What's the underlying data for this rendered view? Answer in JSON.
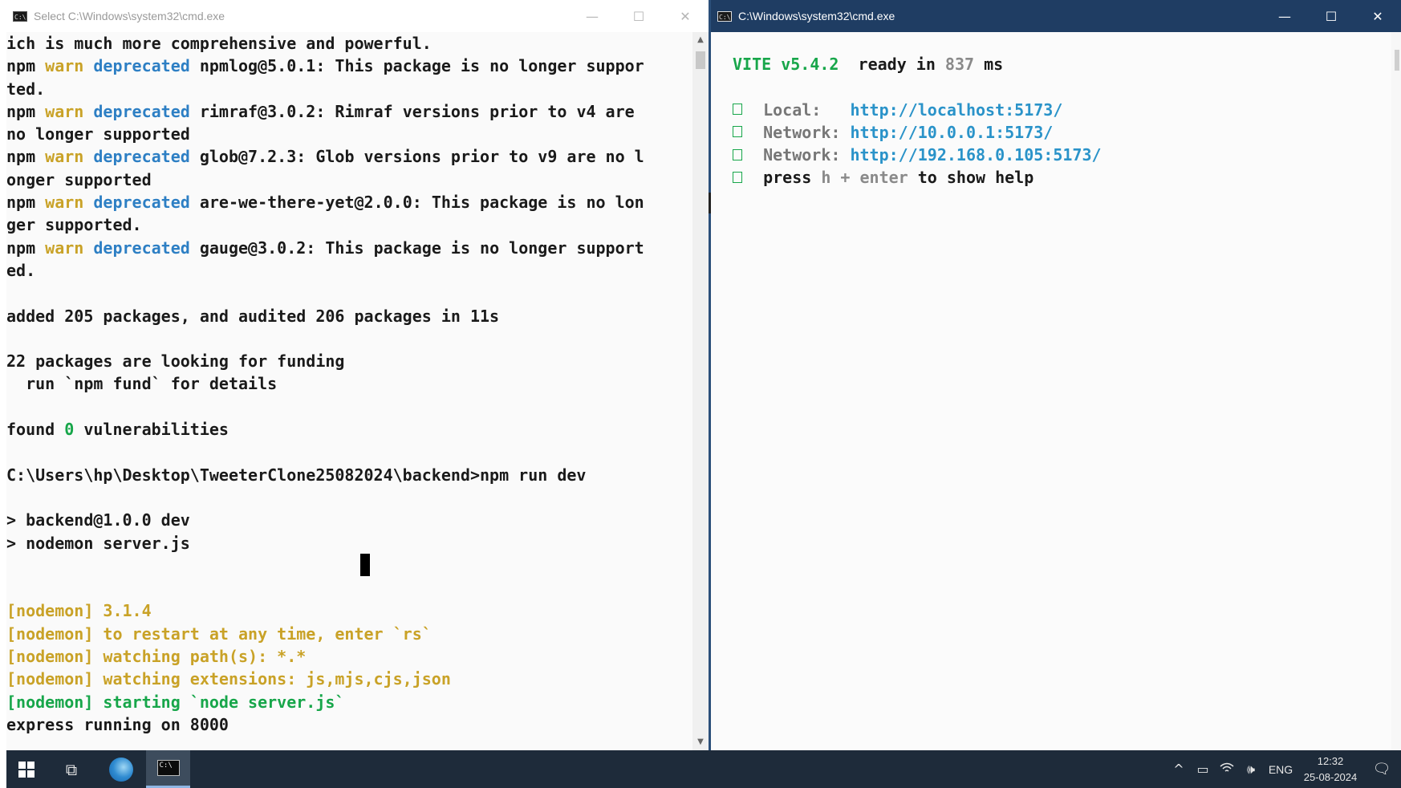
{
  "left_window": {
    "title": "Select C:\\Windows\\system32\\cmd.exe",
    "icon_text": "C:\\",
    "lines": {
      "l1": "ich is much more comprehensive and powerful.",
      "l2_npm": "npm ",
      "l2_warn": "warn",
      "l2_dep": " deprecated",
      "l2_rest": " npmlog@5.0.1: This package is no longer suppor",
      "l3": "ted.",
      "l4_npm": "npm ",
      "l4_warn": "warn",
      "l4_dep": " deprecated",
      "l4_rest": " rimraf@3.0.2: Rimraf versions prior to v4 are",
      "l5": "no longer supported",
      "l6_npm": "npm ",
      "l6_warn": "warn",
      "l6_dep": " deprecated",
      "l6_rest": " glob@7.2.3: Glob versions prior to v9 are no l",
      "l7": "onger supported",
      "l8_npm": "npm ",
      "l8_warn": "warn",
      "l8_dep": " deprecated",
      "l8_rest": " are-we-there-yet@2.0.0: This package is no lon",
      "l9": "ger supported.",
      "l10_npm": "npm ",
      "l10_warn": "warn",
      "l10_dep": " deprecated",
      "l10_rest": " gauge@3.0.2: This package is no longer support",
      "l11": "ed.",
      "l13": "added 205 packages, and audited 206 packages in 11s",
      "l15": "22 packages are looking for funding",
      "l16": "  run `npm fund` for details",
      "l18_a": "found ",
      "l18_zero": "0",
      "l18_b": " vulnerabilities",
      "l20": "C:\\Users\\hp\\Desktop\\TweeterClone25082024\\backend>npm run dev",
      "l22": "> backend@1.0.0 dev",
      "l23": "> nodemon server.js",
      "l26": "[nodemon] 3.1.4",
      "l27": "[nodemon] to restart at any time, enter `rs`",
      "l28": "[nodemon] watching path(s): *.*",
      "l29": "[nodemon] watching extensions: js,mjs,cjs,json",
      "l30": "[nodemon] starting `node server.js`",
      "l31": "express running on 8000"
    }
  },
  "right_window": {
    "title": "C:\\Windows\\system32\\cmd.exe",
    "icon_text": "C:\\",
    "vite_label": "VITE v5.4.2",
    "ready_text": "  ready in ",
    "ready_ms": "837",
    "ms_unit": " ms",
    "local_label": "Local:   ",
    "local_url_a": "http://localhost:",
    "local_port": "5173",
    "local_url_b": "/",
    "network1_label": "Network: ",
    "network1_url_a": "http://10.0.0.1:",
    "network1_port": "5173",
    "network1_url_b": "/",
    "network2_label": "Network: ",
    "network2_url_a": "http://192.168.0.105:",
    "network2_port": "5173",
    "network2_url_b": "/",
    "help_a": "press ",
    "help_key": "h + enter",
    "help_b": " to show help"
  },
  "window_controls": {
    "minimize": "—",
    "maximize": "☐",
    "close": "✕"
  },
  "taskbar": {
    "taskview_glyph": "⧉",
    "tray": {
      "chevron": "^",
      "battery": "▭",
      "volume": "🕪",
      "lang": "ENG",
      "time": "12:32",
      "date": "25-08-2024",
      "notification": "🗨"
    }
  }
}
